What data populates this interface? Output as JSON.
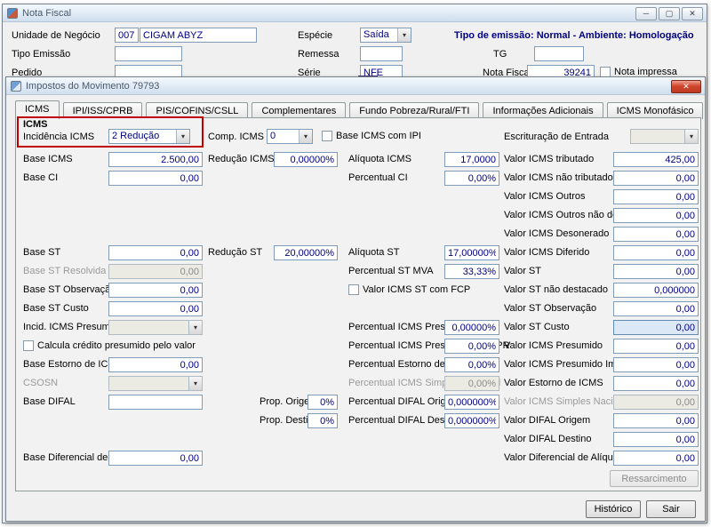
{
  "colors": {
    "accent_navy": "#000080",
    "highlight_red": "#c00000",
    "disabled_text": "#8a8a8a"
  },
  "icons": {
    "minimize": "─",
    "maximize": "▢",
    "close": "✕",
    "dropdown_arrow": "▾"
  },
  "parent": {
    "title": "Nota Fiscal",
    "unidade": {
      "label": "Unidade de Negócio",
      "code": "007",
      "name": "CIGAM ABYZ"
    },
    "especie": {
      "label": "Espécie",
      "value": "Saída"
    },
    "emissao_info": "Tipo de emissão: Normal - Ambiente: Homologação",
    "tipo_emissao": {
      "label": "Tipo Emissão",
      "value": ""
    },
    "remessa": {
      "label": "Remessa",
      "value": ""
    },
    "tg": {
      "label": "TG",
      "value": ""
    },
    "pedido": {
      "label": "Pedido",
      "value": ""
    },
    "serie": {
      "label": "Série",
      "value": "NFE"
    },
    "nota_fiscal": {
      "label": "Nota Fiscal",
      "value": "39241"
    },
    "nota_impressa_label": "Nota impressa"
  },
  "dialog": {
    "title": "Impostos do Movimento 79793",
    "tabs": [
      "ICMS",
      "IPI/ISS/CPRB",
      "PIS/COFINS/CSLL",
      "Complementares",
      "Fundo Pobreza/Rural/FTI",
      "Informações Adicionais",
      "ICMS Monofásico"
    ],
    "group_title": "ICMS",
    "fields": {
      "incidencia_icms": {
        "label": "Incidência ICMS",
        "value": "2 Redução"
      },
      "comp_icms": {
        "label": "Comp. ICMS",
        "value": "0"
      },
      "base_icms_com_ipi": {
        "label": "Base ICMS com IPI"
      },
      "escrituracao_entrada": {
        "label": "Escrituração de Entrada",
        "value": ""
      },
      "base_icms": {
        "label": "Base ICMS",
        "value": "2.500,00"
      },
      "reducao_icms": {
        "label": "Redução ICMS",
        "value": "0,00000%"
      },
      "aliquota_icms": {
        "label": "Alíquota ICMS",
        "value": "17,0000"
      },
      "valor_icms_tributado": {
        "label": "Valor ICMS tributado",
        "value": "425,00"
      },
      "base_ci": {
        "label": "Base CI",
        "value": "0,00"
      },
      "percentual_ci": {
        "label": "Percentual CI",
        "value": "0,00%"
      },
      "valor_icms_nao_tributado": {
        "label": "Valor ICMS não tributado",
        "value": "0,00"
      },
      "valor_icms_outros": {
        "label": "Valor ICMS Outros",
        "value": "0,00"
      },
      "valor_icms_outros_nao_dest": {
        "label": "Valor ICMS Outros não dest.",
        "value": "0,00"
      },
      "valor_icms_desonerado": {
        "label": "Valor ICMS Desonerado",
        "value": "0,00"
      },
      "base_st": {
        "label": "Base ST",
        "value": "0,00"
      },
      "reducao_st": {
        "label": "Redução ST",
        "value": "20,00000%"
      },
      "aliquota_st": {
        "label": "Alíquota ST",
        "value": "17,00000%"
      },
      "valor_icms_diferido": {
        "label": "Valor ICMS Diferido",
        "value": "0,00"
      },
      "base_st_resolvida": {
        "label": "Base ST Resolvida",
        "value": "0,00"
      },
      "percentual_st_mva": {
        "label": "Percentual ST MVA",
        "value": "33,33%"
      },
      "valor_st": {
        "label": "Valor ST",
        "value": "0,00"
      },
      "base_st_observacao": {
        "label": "Base ST Observação",
        "value": "0,00"
      },
      "valor_icms_st_com_fcp": {
        "label": "Valor ICMS ST com FCP"
      },
      "valor_st_nao_destacado": {
        "label": "Valor ST não destacado",
        "value": "0,000000"
      },
      "base_st_custo": {
        "label": "Base ST Custo",
        "value": "0,00"
      },
      "valor_st_observacao": {
        "label": "Valor ST Observação",
        "value": "0,00"
      },
      "incid_icms_presumido": {
        "label": "Incid. ICMS Presumido",
        "value": ""
      },
      "percentual_icms_presumido": {
        "label": "Percentual ICMS Presumido",
        "value": "0,00000%"
      },
      "valor_st_custo": {
        "label": "Valor ST Custo",
        "value": "0,00"
      },
      "calcula_credito": {
        "label": "Calcula crédito presumido pelo valor"
      },
      "percentual_icms_presumido_imp_pr": {
        "label": "Percentual ICMS Presumido Imp. PR",
        "value": "0,00%"
      },
      "valor_icms_presumido": {
        "label": "Valor ICMS Presumido",
        "value": "0,00"
      },
      "base_estorno_icms": {
        "label": "Base Estorno de ICMS",
        "value": "0,00"
      },
      "percentual_estorno_icms": {
        "label": "Percentual Estorno de ICMS",
        "value": "0,00%"
      },
      "valor_icms_presumido_imp_pr": {
        "label": "Valor ICMS Presumido Imp. PR",
        "value": "0,00"
      },
      "csosn": {
        "label": "CSOSN",
        "value": ""
      },
      "percentual_icms_simples": {
        "label": "Percentual ICMS Simples Nacional",
        "value": "0,00%"
      },
      "valor_estorno_icms": {
        "label": "Valor Estorno de ICMS",
        "value": "0,00"
      },
      "base_difal": {
        "label": "Base DIFAL",
        "value": ""
      },
      "prop_origem": {
        "label": "Prop. Origem",
        "value": "0%"
      },
      "percentual_difal_origem": {
        "label": "Percentual DIFAL Origem",
        "value": "0,000000%"
      },
      "valor_icms_simples": {
        "label": "Valor ICMS Simples Nacional",
        "value": "0,00"
      },
      "prop_destino": {
        "label": "Prop. Destino",
        "value": "0%"
      },
      "percentual_difal_destino": {
        "label": "Percentual DIFAL Destino",
        "value": "0,000000%"
      },
      "valor_difal_origem": {
        "label": "Valor DIFAL Origem",
        "value": "0,00"
      },
      "valor_difal_destino": {
        "label": "Valor DIFAL Destino",
        "value": "0,00"
      },
      "base_diferencial_aliq": {
        "label": "Base Diferencial de Alíq.",
        "value": "0,00"
      },
      "valor_diferencial_aliquota": {
        "label": "Valor Diferencial de Alíquota",
        "value": "0,00"
      }
    },
    "buttons": {
      "ressarcimento": "Ressarcimento",
      "historico": "Histórico",
      "sair": "Sair"
    }
  }
}
